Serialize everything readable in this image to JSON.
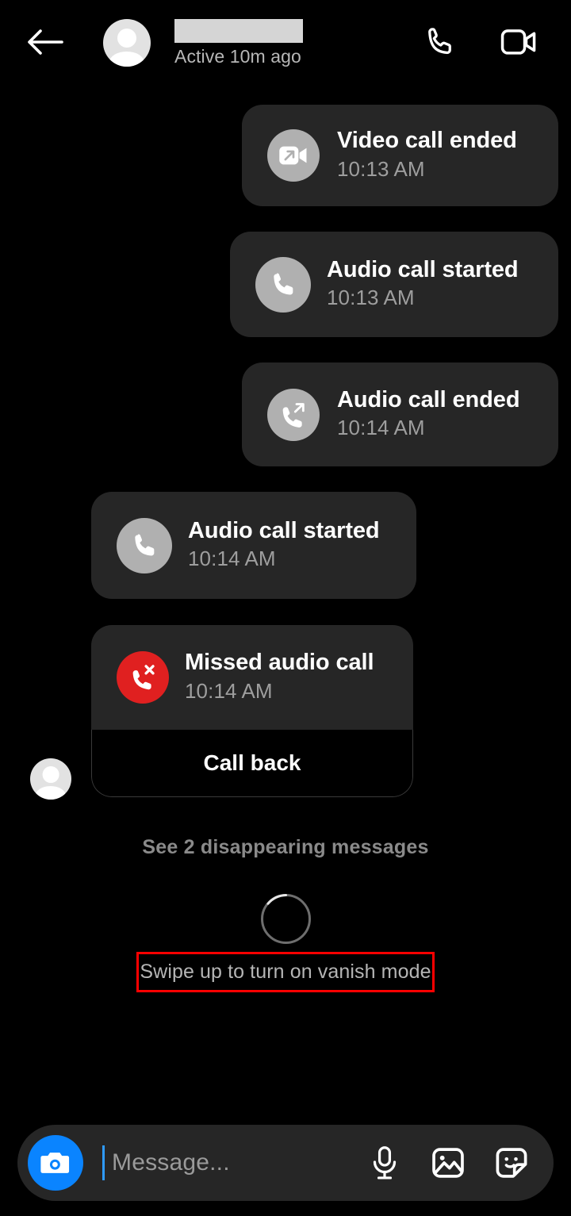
{
  "header": {
    "back_icon": "back-arrow-icon",
    "avatar_icon": "contact-avatar",
    "contact_name": "",
    "status": "Active 10m ago",
    "call_icon": "phone-icon",
    "video_icon": "video-camera-icon"
  },
  "messages": [
    {
      "id": 1,
      "align": "right",
      "title": "Video call ended",
      "time": "10:13 AM",
      "icon": "video-call-outgoing-icon",
      "icon_color": "#b0b0b0"
    },
    {
      "id": 2,
      "align": "right",
      "title": "Audio call started",
      "time": "10:13 AM",
      "icon": "phone-icon",
      "icon_color": "#b0b0b0"
    },
    {
      "id": 3,
      "align": "right",
      "title": "Audio call ended",
      "time": "10:14 AM",
      "icon": "phone-outgoing-icon",
      "icon_color": "#b0b0b0"
    },
    {
      "id": 4,
      "align": "left",
      "title": "Audio call started",
      "time": "10:14 AM",
      "icon": "phone-icon",
      "icon_color": "#b0b0b0"
    },
    {
      "id": 5,
      "align": "left",
      "title": "Missed audio call",
      "time": "10:14 AM",
      "icon": "phone-missed-icon",
      "icon_color": "#e02020",
      "action_label": "Call back"
    }
  ],
  "disappearing": {
    "label": "See 2 disappearing messages"
  },
  "vanish": {
    "hint": "Swipe up to turn on vanish mode",
    "highlight_color": "#ff0000"
  },
  "composer": {
    "camera_icon": "camera-icon",
    "placeholder": "Message...",
    "mic_icon": "microphone-icon",
    "gallery_icon": "image-icon",
    "sticker_icon": "sticker-icon",
    "accent_color": "#0a84ff"
  }
}
